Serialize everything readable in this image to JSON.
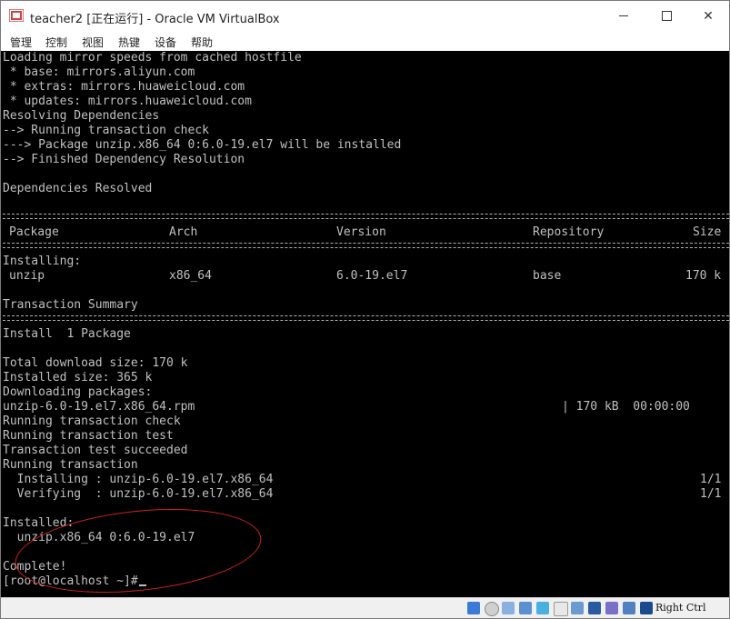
{
  "window": {
    "title": "teacher2 [正在运行] - Oracle VM VirtualBox",
    "menu": [
      "管理",
      "控制",
      "视图",
      "热键",
      "设备",
      "帮助"
    ]
  },
  "console": {
    "lines_top": [
      "Loading mirror speeds from cached hostfile",
      " * base: mirrors.aliyun.com",
      " * extras: mirrors.huaweicloud.com",
      " * updates: mirrors.huaweicloud.com",
      "Resolving Dependencies",
      "--> Running transaction check",
      "---> Package unzip.x86_64 0:6.0-19.el7 will be installed",
      "--> Finished Dependency Resolution",
      "",
      "Dependencies Resolved"
    ],
    "table": {
      "headers": [
        "Package",
        "Arch",
        "Version",
        "Repository",
        "Size"
      ],
      "section": "Installing:",
      "row": [
        "unzip",
        "x86_64",
        "6.0-19.el7",
        "base",
        "170 k"
      ]
    },
    "summary_title": "Transaction Summary",
    "install_count": "Install  1 Package",
    "lines_bottom": [
      "Total download size: 170 k",
      "Installed size: 365 k",
      "Downloading packages:"
    ],
    "download_file": "unzip-6.0-19.el7.x86_64.rpm",
    "download_stats": "| 170 kB  00:00:00",
    "lines_run": [
      "Running transaction check",
      "Running transaction test",
      "Transaction test succeeded",
      "Running transaction"
    ],
    "steps": [
      {
        "text": "  Installing : unzip-6.0-19.el7.x86_64",
        "progress": "1/1"
      },
      {
        "text": "  Verifying  : unzip-6.0-19.el7.x86_64",
        "progress": "1/1"
      }
    ],
    "installed_label": "Installed:",
    "installed_pkg": "  unzip.x86_64 0:6.0-19.el7",
    "complete": "Complete!",
    "prompt": "[root@localhost ~]#"
  },
  "statusbar": {
    "host_key": "Right Ctrl"
  },
  "colors": {
    "console_bg": "#000000",
    "console_fg": "#c0c0c0",
    "annotation": "#d42020"
  }
}
